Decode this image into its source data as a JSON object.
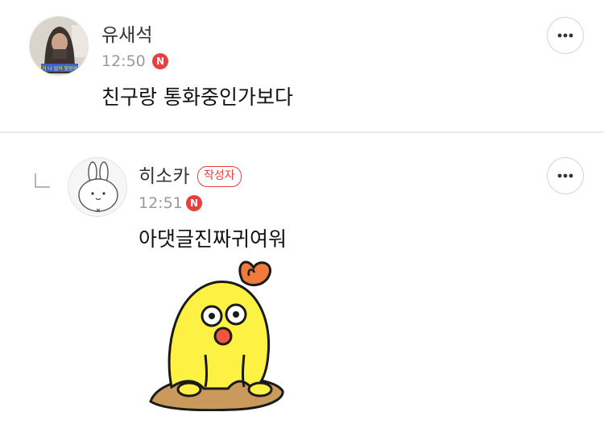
{
  "comments": [
    {
      "author": "유새석",
      "time": "12:50",
      "new_badge": "N",
      "text": "친구랑 통화중인가보다",
      "avatar_caption": "저거 나 있어 맞장려라"
    },
    {
      "author": "히소카",
      "author_badge": "작성자",
      "time": "12:51",
      "new_badge": "N",
      "text": "아댓글진짜귀여워",
      "sticker": "yellow-chick-sticker"
    }
  ],
  "colors": {
    "badge_red": "#e8403d",
    "time_gray": "#9a9a9a",
    "divider": "#ebebeb",
    "sticker_yellow": "#fdf243",
    "sticker_orange": "#f07a3b",
    "sticker_ground": "#c99a5b"
  },
  "icons": {
    "more": "more-dots-icon",
    "reply": "reply-arrow-icon",
    "new": "new-badge-icon"
  }
}
